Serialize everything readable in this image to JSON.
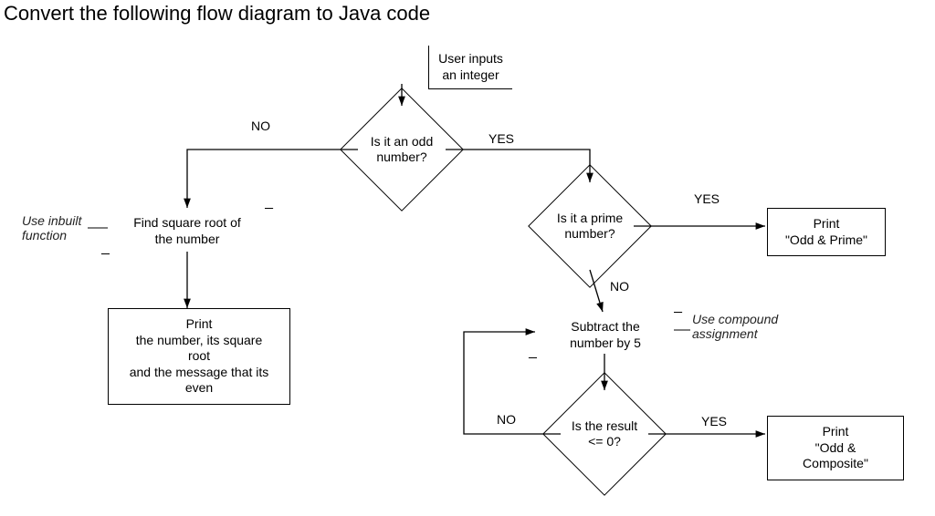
{
  "title": "Convert the following flow diagram to Java code",
  "start": "User inputs\nan integer",
  "decision_odd": "Is it an odd number?",
  "decision_prime": "Is it a prime number?",
  "decision_result": "Is the result <= 0?",
  "process_sqrt": "Find square root of the number",
  "process_subtract": "Subtract the number by 5",
  "print_even": "Print\nthe number, its square root\nand the message that its\neven",
  "print_odd_prime": "Print\n\"Odd & Prime\"",
  "print_odd_composite": "Print\n\"Odd & Composite\"",
  "labels": {
    "yes1": "YES",
    "no1": "NO",
    "yes2": "YES",
    "no2": "NO",
    "yes3": "YES",
    "no3": "NO"
  },
  "annotations": {
    "inbuilt": "Use inbuilt\nfunction",
    "compound": "Use compound\nassignment"
  },
  "chart_data": {
    "type": "flowchart",
    "nodes": [
      {
        "id": "start",
        "kind": "io",
        "text": "User inputs an integer"
      },
      {
        "id": "d_odd",
        "kind": "decision",
        "text": "Is it an odd number?"
      },
      {
        "id": "p_sqrt",
        "kind": "process_io",
        "text": "Find square root of the number",
        "note": "Use inbuilt function"
      },
      {
        "id": "o_even",
        "kind": "output",
        "text": "Print the number, its square root and the message that its even"
      },
      {
        "id": "d_prime",
        "kind": "decision",
        "text": "Is it a prime number?"
      },
      {
        "id": "o_oddprime",
        "kind": "output",
        "text": "Print \"Odd & Prime\""
      },
      {
        "id": "p_sub",
        "kind": "process_io",
        "text": "Subtract the number by 5",
        "note": "Use compound assignment"
      },
      {
        "id": "d_result",
        "kind": "decision",
        "text": "Is the result <= 0?"
      },
      {
        "id": "o_oddcomp",
        "kind": "output",
        "text": "Print \"Odd & Composite\""
      }
    ],
    "edges": [
      {
        "from": "start",
        "to": "d_odd"
      },
      {
        "from": "d_odd",
        "to": "p_sqrt",
        "label": "NO"
      },
      {
        "from": "p_sqrt",
        "to": "o_even"
      },
      {
        "from": "d_odd",
        "to": "d_prime",
        "label": "YES"
      },
      {
        "from": "d_prime",
        "to": "o_oddprime",
        "label": "YES"
      },
      {
        "from": "d_prime",
        "to": "p_sub",
        "label": "NO"
      },
      {
        "from": "p_sub",
        "to": "d_result"
      },
      {
        "from": "d_result",
        "to": "o_oddcomp",
        "label": "YES"
      },
      {
        "from": "d_result",
        "to": "p_sub",
        "label": "NO",
        "loop": true
      }
    ]
  }
}
